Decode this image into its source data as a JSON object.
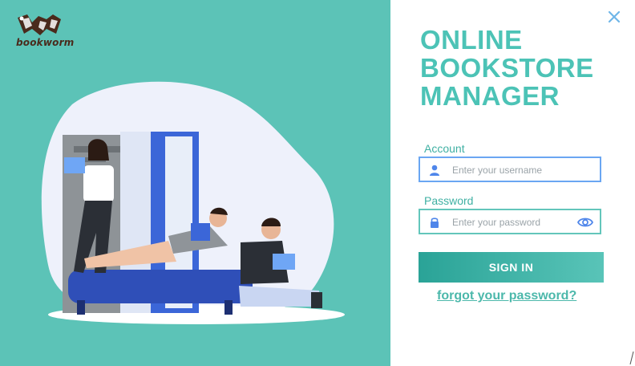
{
  "brand": {
    "logo_text": "bookworm",
    "colors": {
      "teal": "#5cc3b7",
      "title": "#4cc3b6",
      "accent_blue": "#6aa6f2"
    }
  },
  "login": {
    "title_lines": [
      "ONLINE",
      "BOOKSTORE",
      "MANAGER"
    ],
    "account_label": "Account",
    "username_placeholder": "Enter your username",
    "password_label": "Password",
    "password_placeholder": "Enter your password",
    "sign_in_label": "SIGN IN",
    "forgot_label": "forgot your password?"
  },
  "icons": {
    "close": "close-icon",
    "user": "user-icon",
    "lock": "lock-icon",
    "eye": "eye-icon"
  }
}
